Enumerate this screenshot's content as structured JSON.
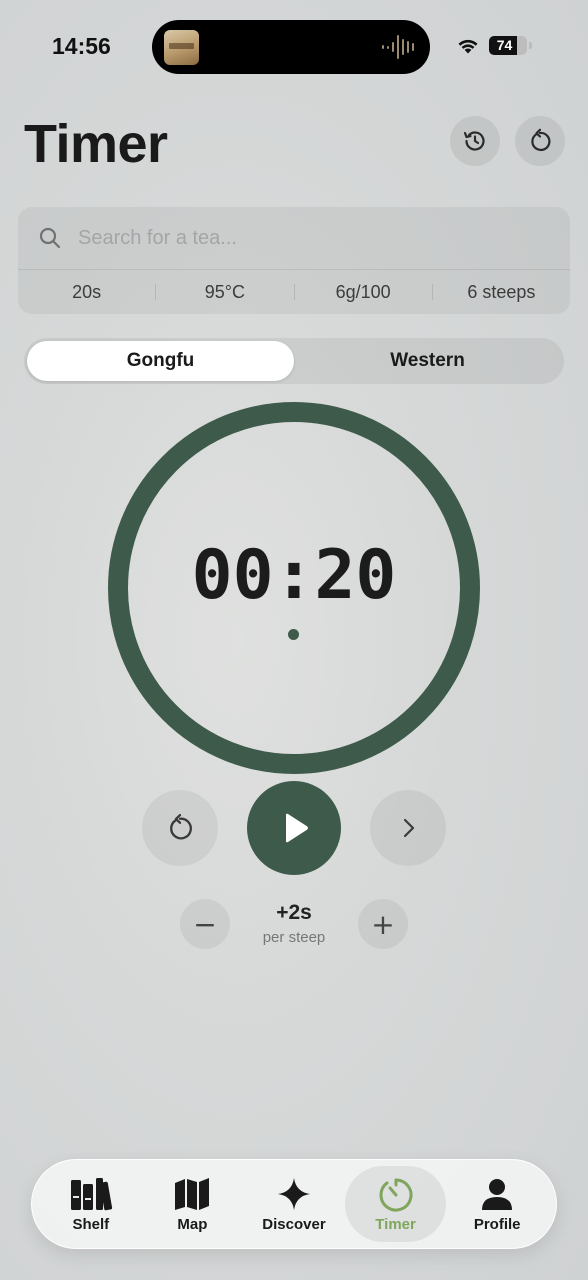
{
  "status_bar": {
    "time": "14:56",
    "battery_level": "74",
    "battery_fraction": 0.74
  },
  "header": {
    "title": "Timer",
    "history_icon": "history-icon",
    "reset_icon": "reset-icon"
  },
  "search": {
    "placeholder": "Search for a tea...",
    "value": ""
  },
  "params": {
    "time": "20s",
    "temperature": "95°C",
    "ratio": "6g/100",
    "steeps": "6 steeps"
  },
  "modes": {
    "options": [
      "Gongfu",
      "Western"
    ],
    "selected": "Gongfu"
  },
  "timer": {
    "display": "00:20",
    "progress": 1.0,
    "accent_color": "#3d5a4a"
  },
  "controls": {
    "restart_icon": "restart-icon",
    "play_icon": "play-icon",
    "next_icon": "chevron-right-icon"
  },
  "increment": {
    "value": "+2s",
    "caption": "per steep",
    "minus": "−",
    "plus": "+"
  },
  "tabbar": {
    "items": [
      {
        "label": "Shelf",
        "icon": "shelf-icon"
      },
      {
        "label": "Map",
        "icon": "map-icon"
      },
      {
        "label": "Discover",
        "icon": "sparkle-icon"
      },
      {
        "label": "Timer",
        "icon": "timer-icon"
      },
      {
        "label": "Profile",
        "icon": "person-icon"
      }
    ],
    "active": "Timer",
    "active_color": "#7fa65c"
  }
}
